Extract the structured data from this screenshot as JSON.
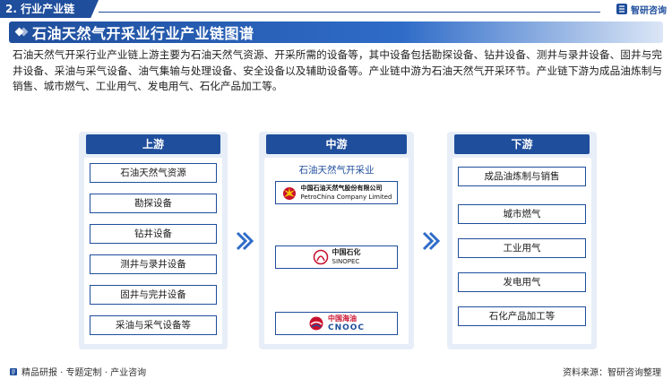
{
  "header": {
    "section_tag": "2. 行业产业链",
    "brand": "智研咨询",
    "title": "石油天然气开采业行业产业链图谱"
  },
  "description": "石油天然气开采行业产业链上游主要为石油天然气资源、开采所需的设备等，其中设备包括勘探设备、钻井设备、测井与录井设备、固井与完井设备、采油与采气设备、油气集输与处理设备、安全设备以及辅助设备等。产业链中游为石油天然气开采环节。产业链下游为成品油炼制与销售、城市燃气、工业用气、发电用气、石化产品加工等。",
  "upstream": {
    "title": "上游",
    "items": [
      "石油天然气资源",
      "勘探设备",
      "钻井设备",
      "测井与录井设备",
      "固井与完井设备",
      "采油与采气设备等"
    ]
  },
  "midstream": {
    "title": "中游",
    "subtitle": "石油天然气开采业",
    "companies": [
      {
        "cn": "中国石油天然气股份有限公司",
        "en": "PetroChina Company Limited"
      },
      {
        "cn": "中国石化",
        "en": "SINOPEC"
      },
      {
        "cn": "中国海油",
        "en": "CNOOC"
      }
    ]
  },
  "downstream": {
    "title": "下游",
    "items": [
      "成品油炼制与销售",
      "城市燃气",
      "工业用气",
      "发电用气",
      "石化产品加工等"
    ]
  },
  "footer": {
    "left": "精品研报 · 专题定制 · 产业咨询",
    "right": "资料来源：智研咨询整理"
  },
  "colors": {
    "primary": "#1f4e9c",
    "panel": "#e7eef8",
    "arrow": "#2f6cc8"
  }
}
